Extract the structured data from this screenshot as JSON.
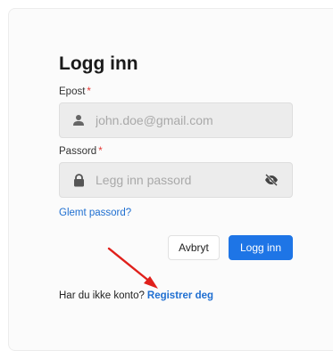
{
  "form": {
    "title": "Logg inn",
    "email": {
      "label": "Epost",
      "required_mark": "*",
      "placeholder": "john.doe@gmail.com",
      "icon": "person-icon"
    },
    "password": {
      "label": "Passord",
      "required_mark": "*",
      "placeholder": "Legg inn passord",
      "icon": "lock-icon",
      "toggle_icon": "eye-off-icon"
    },
    "forgot_link": "Glemt passord?",
    "cancel_label": "Avbryt",
    "login_label": "Logg inn",
    "register_prompt": "Har du ikke konto?",
    "register_link": "Registrer deg"
  },
  "colors": {
    "accent": "#1e75e6",
    "link": "#1f6fd1",
    "required": "#e53935",
    "annotation_arrow": "#e0201b"
  }
}
